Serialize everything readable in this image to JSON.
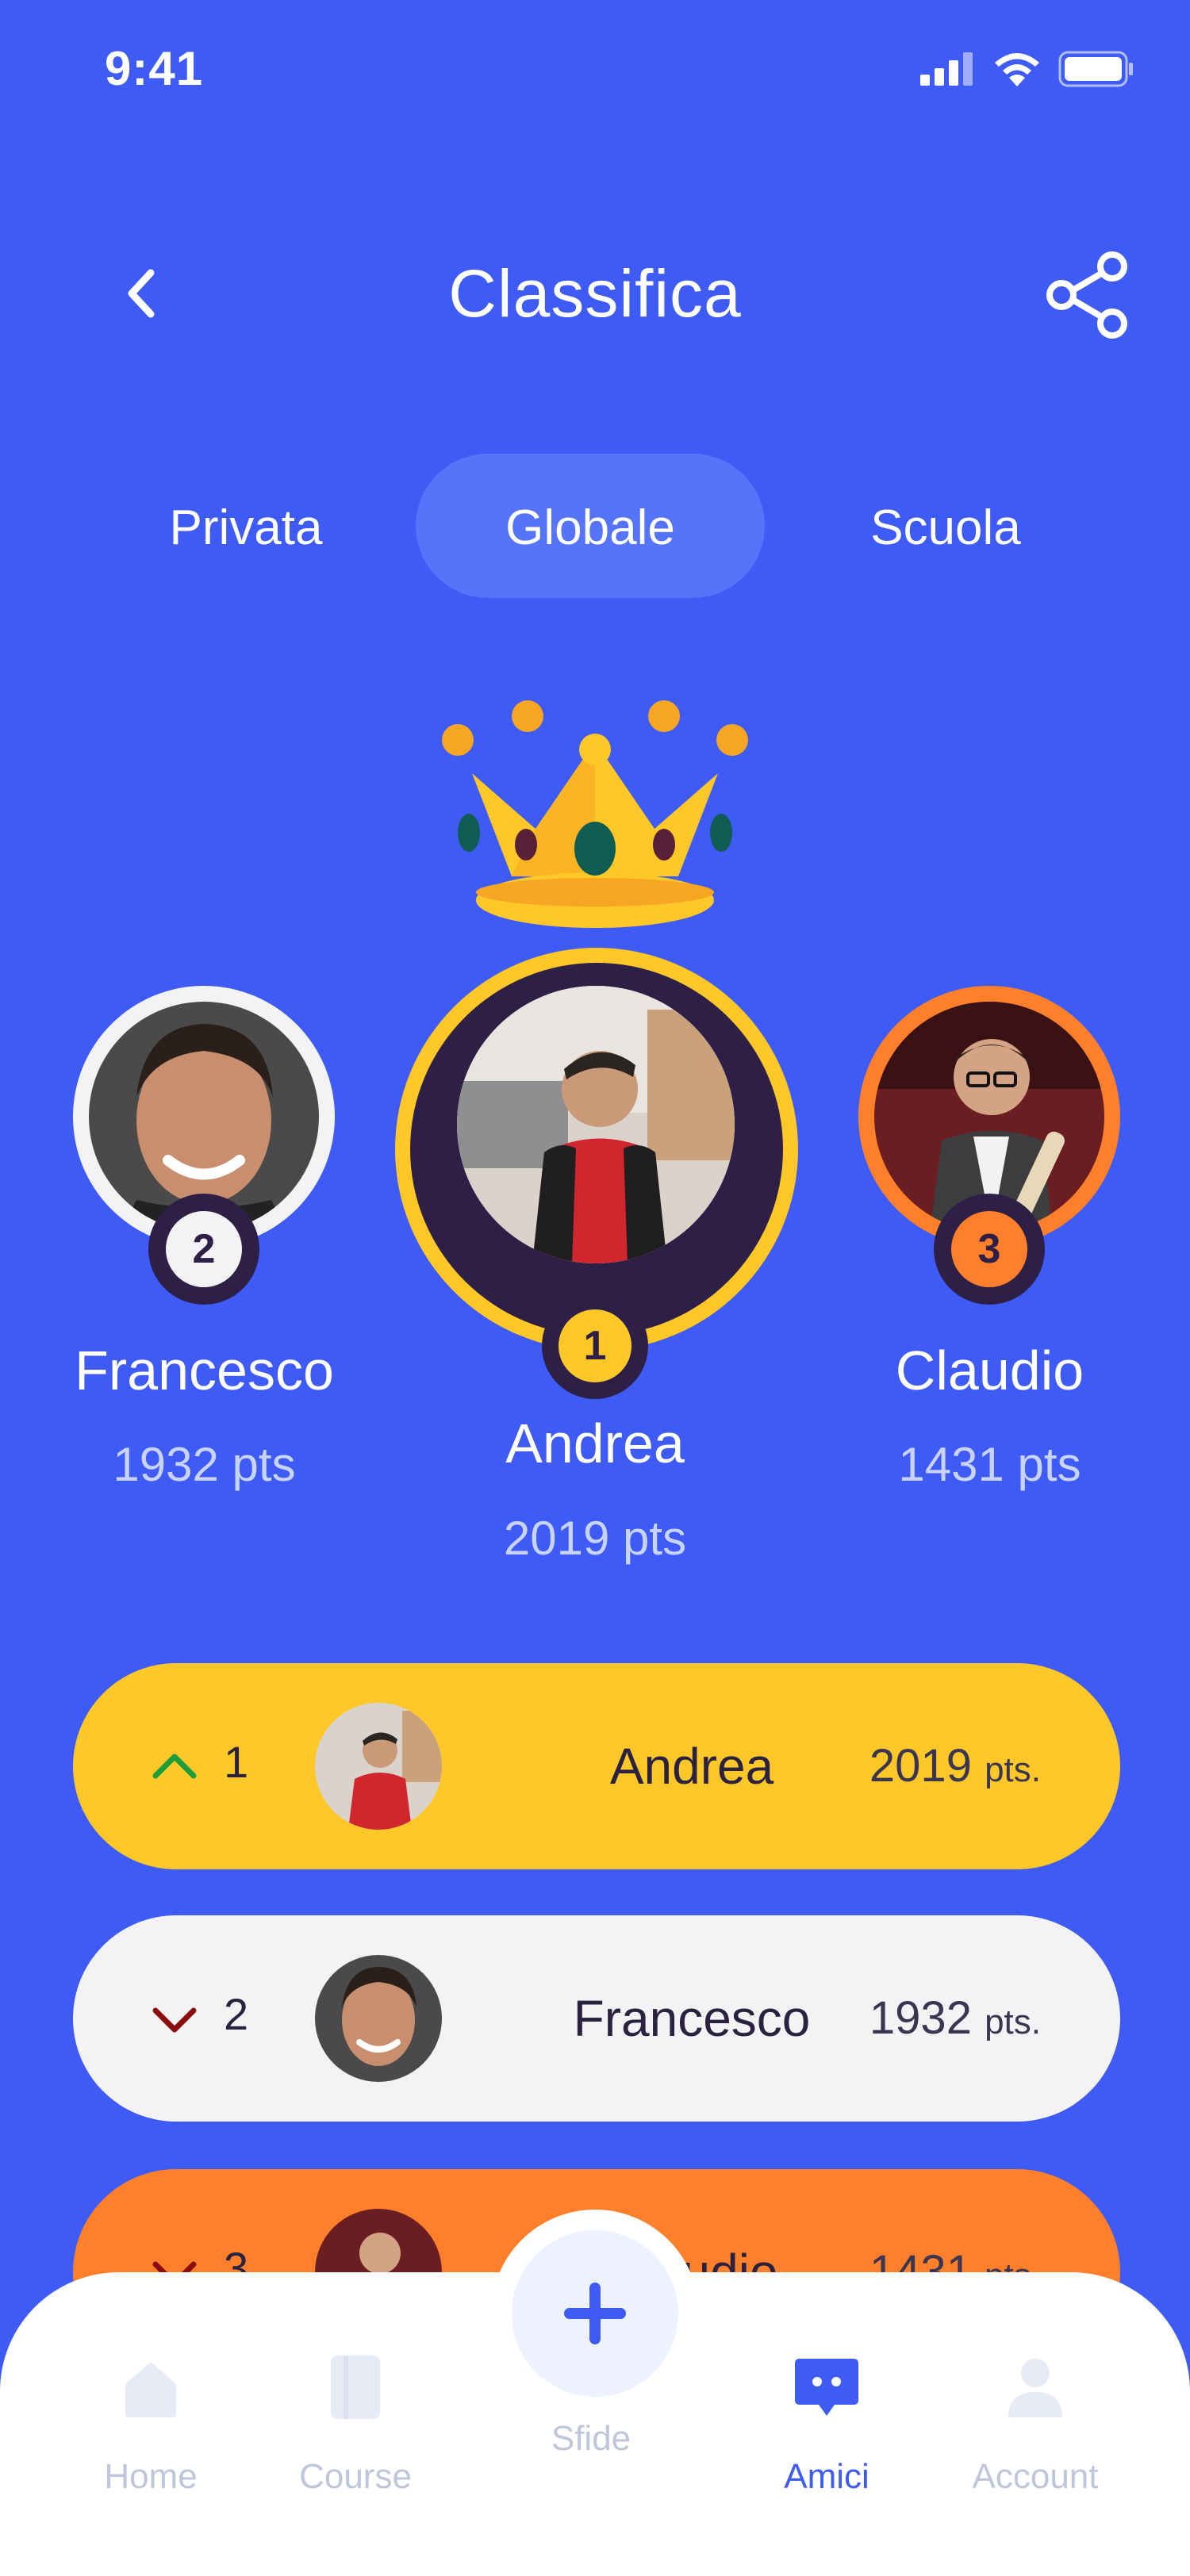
{
  "status_bar": {
    "time": "9:41"
  },
  "header": {
    "title": "Classifica"
  },
  "tabs": [
    {
      "label": "Privata",
      "active": false
    },
    {
      "label": "Globale",
      "active": true
    },
    {
      "label": "Scuola",
      "active": false
    }
  ],
  "podium": {
    "first": {
      "name": "Andrea",
      "points": "2019 pts",
      "rank": "1"
    },
    "second": {
      "name": "Francesco",
      "points": "1932 pts",
      "rank": "2"
    },
    "third": {
      "name": "Claudio",
      "points": "1431 pts",
      "rank": "3"
    }
  },
  "leaderboard": [
    {
      "rank": "1",
      "name": "Andrea",
      "points": "2019",
      "unit": "pts.",
      "trend": "up"
    },
    {
      "rank": "2",
      "name": "Francesco",
      "points": "1932",
      "unit": "pts.",
      "trend": "down"
    },
    {
      "rank": "3",
      "name": "Claudio",
      "points": "1431",
      "unit": "pts.",
      "trend": "down"
    }
  ],
  "nav": [
    {
      "label": "Home"
    },
    {
      "label": "Course"
    },
    {
      "label": "Sfide"
    },
    {
      "label": "Amici"
    },
    {
      "label": "Account"
    }
  ],
  "colors": {
    "background": "#3F5BF6",
    "gold": "#FFC727",
    "silver": "#F3F3F5",
    "bronze": "#FF7F2A",
    "dark": "#2E1F47",
    "nav_active": "#3F5BF6"
  }
}
